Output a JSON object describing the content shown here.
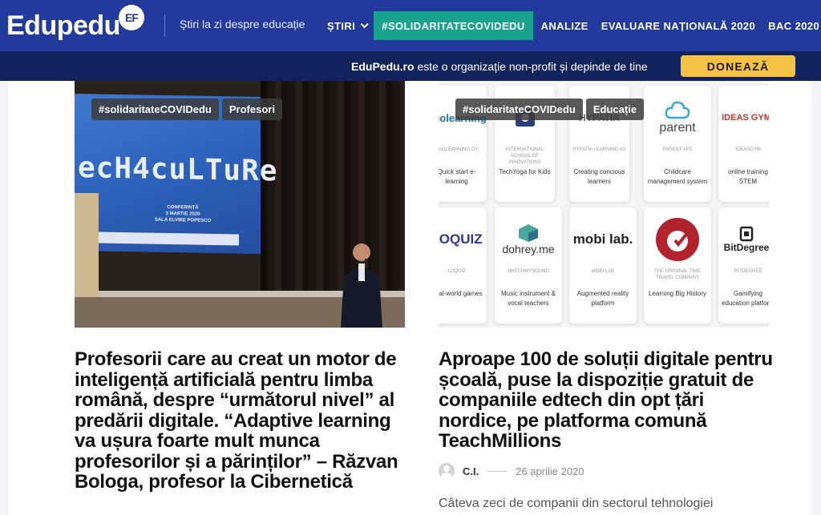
{
  "brand": {
    "logo_text": "Edupedu",
    "logo_badge": "EF",
    "tagline": "Știri la zi despre educație"
  },
  "nav": {
    "items": [
      {
        "label": "ȘTIRI",
        "dropdown": true
      },
      {
        "label": "#SOLIDARITATECOVIDEDU",
        "highlight": true
      },
      {
        "label": "ANALIZE"
      },
      {
        "label": "EVALUARE NAȚIONALĂ 2020"
      },
      {
        "label": "BAC 2020",
        "dropdown": true
      }
    ]
  },
  "donate": {
    "site": "EduPedu.ro",
    "message": " este o organizație non-profit și depinde de tine",
    "button": "DONEAZĂ"
  },
  "colors": {
    "nav_bg": "#213a9c",
    "donate_bg": "#12235c",
    "highlight": "#1aa38c",
    "donate_button": "#f5c242"
  },
  "articles": [
    {
      "tags": [
        "#solidaritateCOVIDedu",
        "Profesori"
      ],
      "title": "Profesorii care au creat un motor de inteligență artificială pentru limba română, despre “următorul nivel” al predării digitale. “Adaptive learning va ușura foarte mult munca profesorilor și a părinților” – Răzvan Bologa, profesor la Cibernetică",
      "image": {
        "screen_title": "ecH4cuLTuRe",
        "screen_lines": [
          "CONFERINȚĂ",
          "3 MARTIE 2020",
          "SALA ELVIRE POPESCO"
        ]
      }
    },
    {
      "tags": [
        "#solidaritateCOVIDedu",
        "Educație"
      ],
      "title": "Aproape 100 de soluții digitale pentru școală, puse la dispoziție gratuit de companiile edtech din opt țări nordice, pe platforma comună TeachMillions",
      "author": "C.I.",
      "date": "26 aprilie 2020",
      "excerpt": "Câteva zeci de companii din sectorul tehnologiei",
      "tiles": [
        {
          "logo": "Vuolearning",
          "company": "VUOLEARNING OY",
          "desc": "Quick start e-learning"
        },
        {
          "logo": "",
          "company": "INTERNATIONAL SCHOOL OF INNOVATIONS",
          "desc": "TechYoga for Kids"
        },
        {
          "logo": "HYPATIA",
          "company": "HYPATIA LEARNING AS",
          "desc": "Creating concious learners"
        },
        {
          "logo": "parent",
          "company": "PARENT APS",
          "desc": "Childcare management system"
        },
        {
          "logo": "IDEAS GYM",
          "company": "IDEASGYM",
          "desc": "online training STEM"
        },
        {
          "logo": "LOQUIZ",
          "company": "LOQUIZ",
          "desc": "Real-world games"
        },
        {
          "logo": "dohrey.me",
          "company": "MATCHMYSOUND",
          "desc": "Music instrument & vocal teachers"
        },
        {
          "logo": "mobi lab.",
          "company": "MOBI LAB",
          "desc": "Augmented reality platform"
        },
        {
          "logo": "",
          "company": "THE ORIGINAL TIME TRAVEL COMPANY",
          "desc": "Learning Big History"
        },
        {
          "logo": "BitDegree",
          "company": "BITDEGREE",
          "desc": "Gamifying education platform"
        }
      ]
    }
  ]
}
